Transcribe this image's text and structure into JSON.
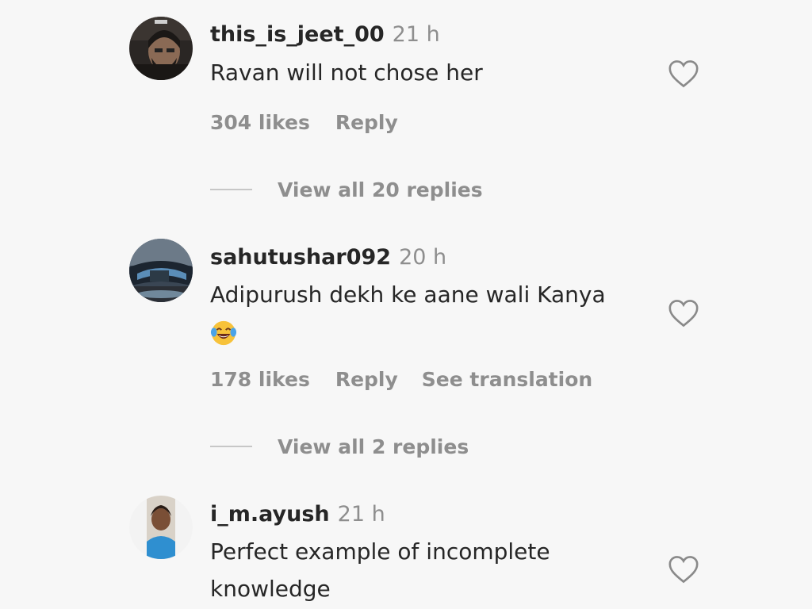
{
  "comments": [
    {
      "username": "this_is_jeet_00",
      "time": "21 h",
      "text": "Ravan will not chose her",
      "likes": "304 likes",
      "reply_label": "Reply",
      "view_replies": "View all 20 replies",
      "avatar_icon": "user-avatar-bearded-man"
    },
    {
      "username": "sahutushar092",
      "time": "20 h",
      "text": "Adipurush dekh ke aane wali Kanya",
      "emoji": "face-with-tears-of-joy-emoji",
      "likes": "178 likes",
      "reply_label": "Reply",
      "translation_label": "See translation",
      "view_replies": "View all 2 replies",
      "avatar_icon": "user-avatar-car-photo"
    },
    {
      "username": "i_m.ayush",
      "time": "21 h",
      "text_line1": "Perfect example of incomplete",
      "text_line2": "knowledge",
      "avatar_icon": "user-avatar-person-blue-shirt"
    }
  ],
  "icons": {
    "like": "heart-outline-icon"
  },
  "colors": {
    "primary_text": "#262626",
    "secondary_text": "#8e8e8e",
    "background": "#f7f7f7"
  }
}
